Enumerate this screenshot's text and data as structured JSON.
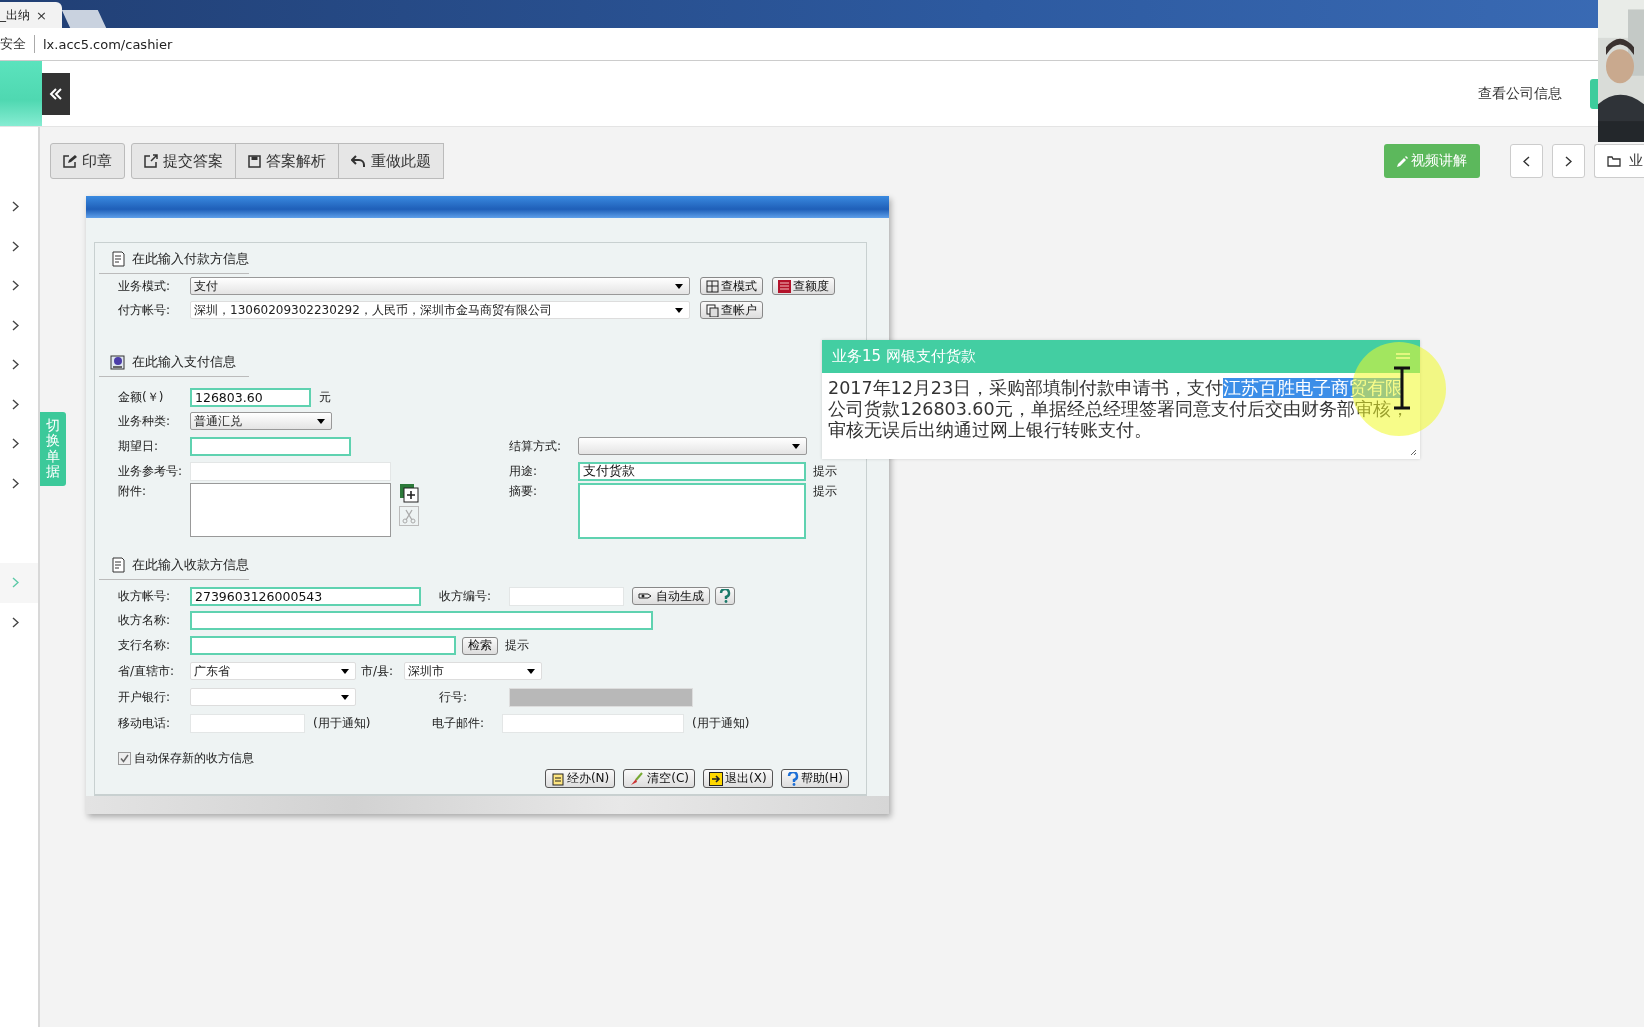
{
  "browser": {
    "tab_title": "_出纳",
    "tab_close": "×",
    "security": "安全",
    "url": "lx.acc5.com/cashier"
  },
  "header": {
    "company_link": "查看公司信息"
  },
  "sidebar": {
    "items": [
      {
        "selected": false
      },
      {
        "selected": false
      },
      {
        "selected": false
      },
      {
        "selected": false
      },
      {
        "selected": false
      },
      {
        "selected": false
      },
      {
        "selected": false
      },
      {
        "selected": false
      }
    ],
    "more_items": [
      {
        "selected": true
      },
      {
        "selected": false
      }
    ]
  },
  "switch_tab": "切换单据",
  "toolbar": {
    "buttons": [
      {
        "kind": "stamp",
        "label": "印章"
      },
      {
        "kind": "submit",
        "label": "提交答案"
      },
      {
        "kind": "analysis",
        "label": "答案解析"
      },
      {
        "kind": "redo",
        "label": "重做此题"
      }
    ],
    "video_button": "视频讲解",
    "folder_button": "业"
  },
  "dialog": {
    "payer": {
      "title": "在此输入付款方信息",
      "mode_label": "业务模式:",
      "mode_value": "支付",
      "mode_buttons": [
        "查模式",
        "查额度"
      ],
      "account_label": "付方帐号:",
      "account_value": "深圳，13060209302230292，人民币，深圳市金马商贸有限公司",
      "account_button": "查帐户"
    },
    "payment": {
      "title": "在此输入支付信息",
      "amount_label": "金额(￥)",
      "amount_value": "126803.60",
      "amount_unit": "元",
      "kind_label": "业务种类:",
      "kind_value": "普通汇兑",
      "date_label": "期望日:",
      "settle_label": "结算方式:",
      "ref_label": "业务参考号:",
      "use_label": "用途:",
      "use_value": "支付货款",
      "use_hint": "提示",
      "attach_label": "附件:",
      "memo_label": "摘要:",
      "memo_hint": "提示"
    },
    "payee": {
      "title": "在此输入收款方信息",
      "account_label": "收方帐号:",
      "account_value": "2739603126000543",
      "code_label": "收方编号:",
      "auto_button": "自动生成",
      "name_label": "收方名称:",
      "branch_label": "支行名称:",
      "search_button": "检索",
      "branch_hint": "提示",
      "province_label": "省/直辖市:",
      "province_value": "广东省",
      "city_label": "市/县:",
      "city_value": "深圳市",
      "bank_label": "开户银行:",
      "bankno_label": "行号:",
      "phone_label": "移动电话:",
      "phone_note": "(用于通知)",
      "email_label": "电子邮件:",
      "email_note": "(用于通知)"
    },
    "auto_save": {
      "label": "自动保存新的收方信息",
      "checked": true
    },
    "actions": [
      {
        "kind": "handle",
        "label": "经办(N)"
      },
      {
        "kind": "clear",
        "label": "清空(C)"
      },
      {
        "kind": "exit",
        "label": "退出(X)"
      },
      {
        "kind": "help",
        "label": "帮助(H)"
      }
    ]
  },
  "task": {
    "title": "业务15 网银支付货款",
    "description": [
      {
        "text": "2017年12月23日，采购部填制付款申请书，支付",
        "selected": false
      },
      {
        "text": "江苏百胜电子商贸有限",
        "selected": true
      },
      {
        "text": "公司货款126803.60元，单据经总经理签署同意支付后交由财务部审核，审核无误后出纳通过网上银行转账支付。",
        "selected": false
      }
    ]
  }
}
